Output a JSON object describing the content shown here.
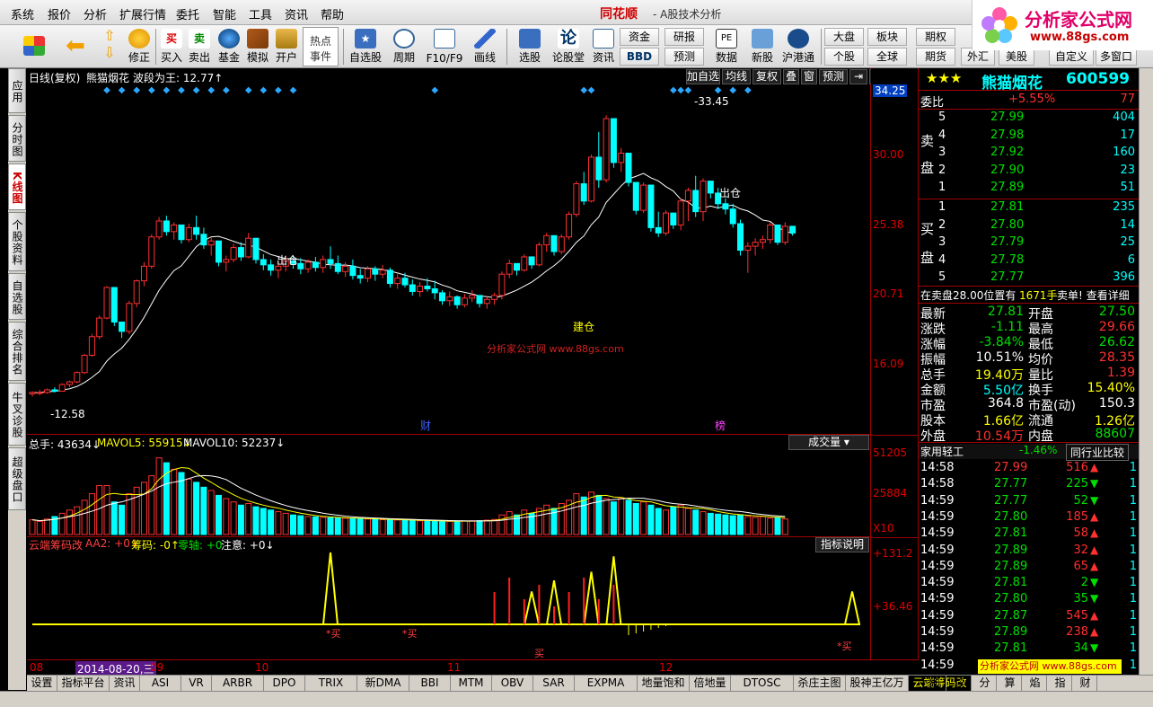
{
  "menu": {
    "items": [
      "系统",
      "报价",
      "分析",
      "扩展行情",
      "委托",
      "智能",
      "工具",
      "资讯",
      "帮助"
    ],
    "brand": "同花顺",
    "subtitle": "- A股技术分析"
  },
  "logo": {
    "title": "分析家公式网",
    "site": "www.88gs.com"
  },
  "toolbar": {
    "buttons": [
      "修正",
      "买入",
      "卖出",
      "基金",
      "模拟",
      "开户",
      "热点事件",
      "自选股",
      "周期",
      "F10/F9",
      "画线",
      "选股",
      "论股堂",
      "资讯",
      "数据",
      "新股",
      "沪港通"
    ],
    "hot_line1": "热点",
    "hot_line2": "事件",
    "small": {
      "zijin": "资金",
      "yanbao": "研报",
      "bbd": "BBD",
      "yuce": "预测",
      "dapan": "大盘",
      "bankuai": "板块",
      "qihuan": "期权",
      "quanqiu": "全球",
      "qihuo": "期货",
      "zidingyi": "自定义",
      "duochuangkou": "多窗口",
      "ge": "个股",
      "waihui": "外汇",
      "meigu": "美股"
    }
  },
  "left_tabs": [
    "应用",
    "分时图",
    "K线图",
    "个股资料",
    "自选股",
    "综合排名",
    "牛叉诊股",
    "超级盘口"
  ],
  "kline": {
    "header_period": "日线(复权)",
    "header_name": "熊猫烟花",
    "header_indicator": "波段为王: 12.77↑",
    "buttons": [
      "加自选",
      "均线",
      "复权",
      "叠",
      "窗",
      "预测"
    ],
    "high_label": "33.45",
    "low_label": "12.58",
    "sig_out1": "出仓",
    "sig_out2": "出仓",
    "sig_build": "建仓",
    "watermark": "分析家公式网 www.88gs.com",
    "event_cai": "财",
    "event_bang": "榜",
    "y_axis": [
      "34.25",
      "30.00",
      "25.38",
      "20.71",
      "16.09"
    ]
  },
  "volume": {
    "header_total": "总手: 43634↓",
    "header_ma5": "MAVOL5: 55915↓",
    "header_ma10": "MAVOL10: 52237↓",
    "dropdown": "成交量",
    "y_axis": [
      "51205",
      "25884",
      "X10"
    ]
  },
  "indicator": {
    "name": "云端筹码改",
    "aa2": "AA2: +0↓",
    "chouma": "筹码: -0↑",
    "lingzhou": "零轴: +0",
    "zhuyi": "注意: +0↓",
    "explain": "指标说明",
    "buy_label": "*买",
    "y_axis": [
      "+131.2",
      "+36.46"
    ]
  },
  "date_axis": {
    "labels": [
      "08",
      "09",
      "10",
      "11",
      "12"
    ],
    "cursor_date": "2014-08-20,三"
  },
  "bottom_tabs": [
    "设置",
    "指标平台",
    "资讯",
    "ASI",
    "VR",
    "ARBR",
    "DPO",
    "TRIX",
    "新DMA",
    "BBI",
    "MTM",
    "OBV",
    "SAR",
    "EXPMA",
    "地量饱和",
    "倍地量",
    "DTOSC",
    "杀庄主图",
    "股神王亿万",
    "云端筹码改"
  ],
  "bottom_right_tabs": [
    "细",
    "诊",
    "分",
    "算",
    "焰",
    "指",
    "财"
  ],
  "quote": {
    "name": "熊猫烟花",
    "code": "600599",
    "weibi_label": "委比",
    "weibi_value": "+5.55%",
    "weibi_diff": "77",
    "sell_label1": "卖",
    "sell_label2": "盘",
    "buy_label1": "买",
    "buy_label2": "盘",
    "sells": [
      {
        "lv": "5",
        "price": "27.99",
        "vol": "404"
      },
      {
        "lv": "4",
        "price": "27.98",
        "vol": "17"
      },
      {
        "lv": "3",
        "price": "27.92",
        "vol": "160"
      },
      {
        "lv": "2",
        "price": "27.90",
        "vol": "23"
      },
      {
        "lv": "1",
        "price": "27.89",
        "vol": "51"
      }
    ],
    "buys": [
      {
        "lv": "1",
        "price": "27.81",
        "vol": "235"
      },
      {
        "lv": "2",
        "price": "27.80",
        "vol": "14"
      },
      {
        "lv": "3",
        "price": "27.79",
        "vol": "25"
      },
      {
        "lv": "4",
        "price": "27.78",
        "vol": "6"
      },
      {
        "lv": "5",
        "price": "27.77",
        "vol": "396"
      }
    ],
    "order_note": "在卖盘28.00位置有",
    "order_vol": "1671手",
    "order_tail": "卖单! 查看详细",
    "stats_left": [
      {
        "k": "最新",
        "v": "27.81",
        "c": "c-green"
      },
      {
        "k": "涨跌",
        "v": "-1.11",
        "c": "c-green"
      },
      {
        "k": "涨幅",
        "v": "-3.84%",
        "c": "c-green"
      },
      {
        "k": "振幅",
        "v": "10.51%",
        "c": "c-white"
      },
      {
        "k": "总手",
        "v": "19.40万",
        "c": "c-yel"
      },
      {
        "k": "金额",
        "v": "5.50亿",
        "c": "c-cyan"
      },
      {
        "k": "市盈",
        "v": "364.8",
        "c": "c-white"
      },
      {
        "k": "股本",
        "v": "1.66亿",
        "c": "c-yel"
      },
      {
        "k": "外盘",
        "v": "10.54万",
        "c": "c-red"
      }
    ],
    "stats_right": [
      {
        "k": "开盘",
        "v": "27.50",
        "c": "c-green"
      },
      {
        "k": "最高",
        "v": "29.66",
        "c": "c-red"
      },
      {
        "k": "最低",
        "v": "26.62",
        "c": "c-green"
      },
      {
        "k": "均价",
        "v": "28.35",
        "c": "c-red"
      },
      {
        "k": "量比",
        "v": "1.39",
        "c": "c-red"
      },
      {
        "k": "换手",
        "v": "15.40%",
        "c": "c-yel"
      },
      {
        "k": "市盈(动)",
        "v": "150.3",
        "c": "c-white"
      },
      {
        "k": "流通",
        "v": "1.26亿",
        "c": "c-yel"
      },
      {
        "k": "内盘",
        "v": "88607",
        "c": "c-green"
      }
    ],
    "industry": "家用轻工",
    "industry_change": "-1.46%",
    "industry_compare": "同行业比较",
    "ticks": [
      {
        "t": "14:58",
        "p": "27.99",
        "v": "516",
        "dir": "up",
        "pc": "c-red"
      },
      {
        "t": "14:58",
        "p": "27.77",
        "v": "225",
        "dir": "down",
        "pc": "c-green"
      },
      {
        "t": "14:59",
        "p": "27.77",
        "v": "52",
        "dir": "down",
        "pc": "c-green"
      },
      {
        "t": "14:59",
        "p": "27.80",
        "v": "185",
        "dir": "up",
        "pc": "c-green"
      },
      {
        "t": "14:59",
        "p": "27.81",
        "v": "58",
        "dir": "up",
        "pc": "c-green"
      },
      {
        "t": "14:59",
        "p": "27.89",
        "v": "32",
        "dir": "up",
        "pc": "c-green"
      },
      {
        "t": "14:59",
        "p": "27.89",
        "v": "65",
        "dir": "up",
        "pc": "c-green"
      },
      {
        "t": "14:59",
        "p": "27.81",
        "v": "2",
        "dir": "down",
        "pc": "c-green"
      },
      {
        "t": "14:59",
        "p": "27.80",
        "v": "35",
        "dir": "down",
        "pc": "c-green"
      },
      {
        "t": "14:59",
        "p": "27.87",
        "v": "545",
        "dir": "up",
        "pc": "c-green"
      },
      {
        "t": "14:59",
        "p": "27.89",
        "v": "238",
        "dir": "up",
        "pc": "c-green"
      },
      {
        "t": "14:59",
        "p": "27.81",
        "v": "34",
        "dir": "down",
        "pc": "c-green"
      },
      {
        "t": "14:59",
        "p": "",
        "v": "",
        "dir": "",
        "pc": "c-green"
      }
    ],
    "tick_extra": [
      "1",
      "1",
      "1",
      "1",
      "1",
      "1",
      "1",
      "1",
      "1",
      "1",
      "1",
      "1",
      "1"
    ],
    "footer_watermark": "分析家公式网 www.88gs.com"
  },
  "chart_data": {
    "type": "candlestick",
    "title": "熊猫烟花 600599 日线(复权)",
    "ylim": [
      10.5,
      35.5
    ],
    "candles": [
      [
        12.5,
        12.7,
        12.3,
        12.6
      ],
      [
        12.6,
        12.8,
        12.4,
        12.6
      ],
      [
        12.6,
        12.9,
        12.5,
        12.8
      ],
      [
        12.8,
        13.0,
        12.6,
        12.7
      ],
      [
        12.7,
        13.3,
        12.7,
        13.2
      ],
      [
        13.2,
        13.5,
        13.0,
        13.4
      ],
      [
        13.4,
        14.2,
        13.3,
        14.1
      ],
      [
        14.1,
        15.5,
        14.0,
        15.4
      ],
      [
        15.4,
        17.0,
        15.3,
        16.8
      ],
      [
        16.8,
        18.4,
        16.6,
        18.2
      ],
      [
        18.2,
        20.6,
        18.1,
        20.5
      ],
      [
        20.5,
        18.9,
        17.6,
        17.9
      ],
      [
        17.9,
        17.5,
        16.7,
        17.2
      ],
      [
        17.2,
        19.5,
        17.0,
        19.3
      ],
      [
        19.3,
        21.1,
        19.0,
        21.0
      ],
      [
        21.0,
        22.4,
        20.6,
        22.1
      ],
      [
        22.1,
        24.5,
        21.9,
        24.3
      ],
      [
        24.3,
        25.8,
        24.1,
        25.5
      ],
      [
        25.5,
        25.9,
        24.4,
        24.7
      ],
      [
        24.7,
        25.4,
        24.1,
        25.2
      ],
      [
        25.2,
        24.9,
        23.8,
        24.1
      ],
      [
        24.1,
        25.3,
        23.9,
        25.0
      ],
      [
        25.0,
        25.9,
        24.1,
        24.5
      ],
      [
        24.5,
        25.0,
        23.4,
        23.7
      ],
      [
        23.7,
        24.3,
        22.9,
        24.0
      ],
      [
        24.0,
        23.8,
        22.1,
        22.4
      ],
      [
        22.4,
        22.9,
        21.7,
        22.6
      ],
      [
        22.6,
        23.8,
        22.4,
        23.5
      ],
      [
        23.5,
        23.9,
        22.5,
        22.8
      ],
      [
        22.8,
        24.6,
        22.7,
        24.2
      ],
      [
        24.2,
        23.9,
        22.3,
        22.6
      ],
      [
        22.6,
        23.0,
        21.8,
        22.2
      ],
      [
        22.2,
        22.6,
        21.4,
        21.8
      ],
      [
        21.8,
        22.4,
        21.2,
        22.1
      ],
      [
        22.1,
        22.9,
        21.7,
        22.5
      ],
      [
        22.5,
        22.9,
        21.9,
        22.3
      ],
      [
        22.3,
        22.7,
        21.5,
        21.9
      ],
      [
        21.9,
        22.6,
        21.6,
        22.4
      ],
      [
        22.4,
        22.8,
        21.7,
        22.0
      ],
      [
        22.0,
        22.9,
        21.6,
        22.6
      ],
      [
        22.6,
        23.6,
        21.9,
        22.3
      ],
      [
        22.3,
        22.9,
        21.5,
        21.7
      ],
      [
        21.7,
        22.4,
        21.3,
        22.1
      ],
      [
        22.1,
        22.6,
        21.1,
        21.4
      ],
      [
        21.4,
        21.9,
        20.8,
        21.2
      ],
      [
        21.2,
        22.1,
        20.9,
        21.9
      ],
      [
        21.9,
        22.1,
        21.0,
        21.5
      ],
      [
        21.5,
        22.2,
        21.2,
        21.8
      ],
      [
        21.8,
        22.0,
        20.5,
        20.8
      ],
      [
        20.8,
        21.5,
        20.4,
        21.2
      ],
      [
        21.2,
        21.6,
        20.5,
        20.7
      ],
      [
        20.7,
        21.1,
        19.9,
        20.2
      ],
      [
        20.2,
        20.9,
        19.8,
        20.6
      ],
      [
        20.6,
        21.2,
        20.2,
        20.4
      ],
      [
        20.4,
        21.0,
        19.6,
        20.1
      ],
      [
        20.1,
        20.3,
        19.2,
        19.5
      ],
      [
        19.5,
        20.2,
        19.1,
        19.8
      ],
      [
        19.8,
        19.9,
        18.9,
        19.2
      ],
      [
        19.2,
        20.0,
        19.0,
        19.7
      ],
      [
        19.7,
        20.3,
        19.4,
        19.9
      ],
      [
        19.9,
        19.9,
        19.0,
        19.3
      ],
      [
        19.3,
        19.8,
        18.9,
        19.6
      ],
      [
        19.6,
        20.1,
        19.2,
        19.9
      ],
      [
        19.9,
        21.7,
        19.6,
        21.5
      ],
      [
        21.5,
        22.6,
        21.2,
        22.3
      ],
      [
        22.3,
        22.1,
        21.4,
        21.8
      ],
      [
        21.8,
        23.0,
        21.7,
        22.8
      ],
      [
        22.8,
        22.5,
        21.9,
        22.2
      ],
      [
        22.2,
        23.9,
        22.1,
        23.7
      ],
      [
        23.7,
        24.6,
        23.2,
        24.4
      ],
      [
        24.4,
        24.0,
        22.9,
        23.2
      ],
      [
        23.2,
        24.5,
        23.0,
        24.3
      ],
      [
        24.3,
        26.2,
        24.1,
        26.0
      ],
      [
        26.0,
        28.5,
        25.8,
        28.3
      ],
      [
        28.3,
        29.2,
        26.7,
        27.0
      ],
      [
        27.0,
        30.5,
        26.9,
        30.3
      ],
      [
        30.3,
        32.2,
        28.0,
        28.6
      ],
      [
        28.6,
        33.45,
        28.4,
        33.2
      ],
      [
        33.2,
        32.8,
        29.5,
        29.9
      ],
      [
        29.9,
        31.0,
        29.2,
        30.6
      ],
      [
        30.6,
        30.2,
        28.1,
        28.4
      ],
      [
        28.4,
        28.1,
        26.0,
        26.3
      ],
      [
        26.3,
        28.4,
        26.1,
        28.2
      ],
      [
        28.2,
        27.6,
        24.7,
        25.0
      ],
      [
        25.0,
        26.2,
        24.3,
        24.6
      ],
      [
        24.6,
        26.3,
        24.4,
        26.1
      ],
      [
        26.1,
        26.0,
        24.9,
        25.2
      ],
      [
        25.2,
        27.2,
        24.8,
        27.0
      ],
      [
        27.0,
        28.0,
        25.5,
        27.8
      ],
      [
        27.8,
        28.9,
        25.8,
        26.2
      ],
      [
        26.2,
        28.7,
        25.5,
        28.5
      ],
      [
        28.5,
        28.2,
        27.2,
        27.6
      ],
      [
        27.6,
        28.0,
        26.4,
        26.8
      ],
      [
        26.8,
        27.2,
        26.0,
        26.4
      ],
      [
        26.4,
        26.8,
        25.0,
        25.3
      ],
      [
        25.3,
        25.6,
        22.9,
        23.3
      ],
      [
        23.3,
        23.9,
        21.6,
        23.6
      ],
      [
        23.6,
        24.2,
        22.9,
        23.9
      ],
      [
        23.9,
        24.4,
        23.4,
        24.1
      ],
      [
        24.1,
        25.4,
        23.8,
        25.2
      ],
      [
        25.2,
        24.8,
        23.7,
        23.9
      ],
      [
        23.9,
        25.4,
        23.7,
        25.1
      ],
      [
        25.1,
        25.0,
        24.4,
        24.6
      ]
    ],
    "volume": [
      9000,
      8000,
      9500,
      11000,
      13000,
      15000,
      17000,
      21000,
      25000,
      30000,
      30000,
      20000,
      18000,
      25000,
      29000,
      32000,
      36000,
      47000,
      44000,
      40000,
      38000,
      34000,
      32000,
      29000,
      27000,
      24000,
      22000,
      20000,
      18000,
      19000,
      17000,
      16000,
      15000,
      14000,
      13000,
      12000,
      11500,
      11000,
      10800,
      10500,
      10300,
      10100,
      10000,
      9800,
      9600,
      9500,
      9300,
      9100,
      9000,
      8900,
      8800,
      8600,
      8400,
      8300,
      8200,
      8000,
      8100,
      8200,
      8300,
      8400,
      8500,
      8800,
      9200,
      12000,
      14000,
      12000,
      15000,
      13000,
      16000,
      18000,
      16000,
      19000,
      21000,
      25000,
      23000,
      26000,
      24000,
      22000,
      20000,
      22000,
      21000,
      19000,
      20000,
      18000,
      16000,
      15000,
      17000,
      18000,
      16000,
      15000,
      14000,
      13000,
      12500,
      12000,
      11500,
      12000,
      11000,
      10500,
      11000,
      10000,
      10500,
      9500
    ],
    "indicator_peaks": [
      [
        40,
        131.2
      ],
      [
        67,
        60
      ],
      [
        70,
        80
      ],
      [
        75,
        96
      ],
      [
        78,
        124
      ],
      [
        110,
        60
      ],
      [
        126,
        96
      ]
    ]
  }
}
